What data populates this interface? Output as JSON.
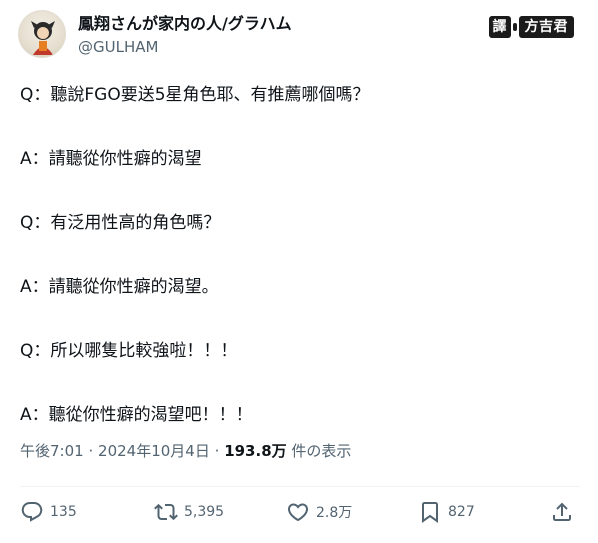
{
  "author": {
    "display_name": "鳳翔さんが家内の人/グラハム",
    "handle": "@GULHAM"
  },
  "translator_badge": {
    "tag": "譯",
    "name": "方吉君"
  },
  "tweet": {
    "lines": [
      "Q：聽說FGO要送5星角色耶、有推薦哪個嗎？",
      "A：請聽從你性癖的渴望",
      "Q：有泛用性高的角色嗎？",
      "A：請聽從你性癖的渴望。",
      "Q：所以哪隻比較強啦！！！",
      "A：聽從你性癖的渴望吧！！！"
    ]
  },
  "meta": {
    "time": "午後7:01",
    "sep1": "·",
    "date": "2024年10月4日",
    "sep2": "·",
    "views": "193.8万",
    "views_label": "件の表示"
  },
  "actions": {
    "reply_count": "135",
    "retweet_count": "5,395",
    "like_count": "2.8万",
    "bookmark_count": "827",
    "icons": [
      "reply-icon",
      "retweet-icon",
      "like-icon",
      "bookmark-icon",
      "share-icon"
    ]
  },
  "colors": {
    "text": "#0f1419",
    "secondary": "#536471",
    "divider": "#eff3f4"
  }
}
